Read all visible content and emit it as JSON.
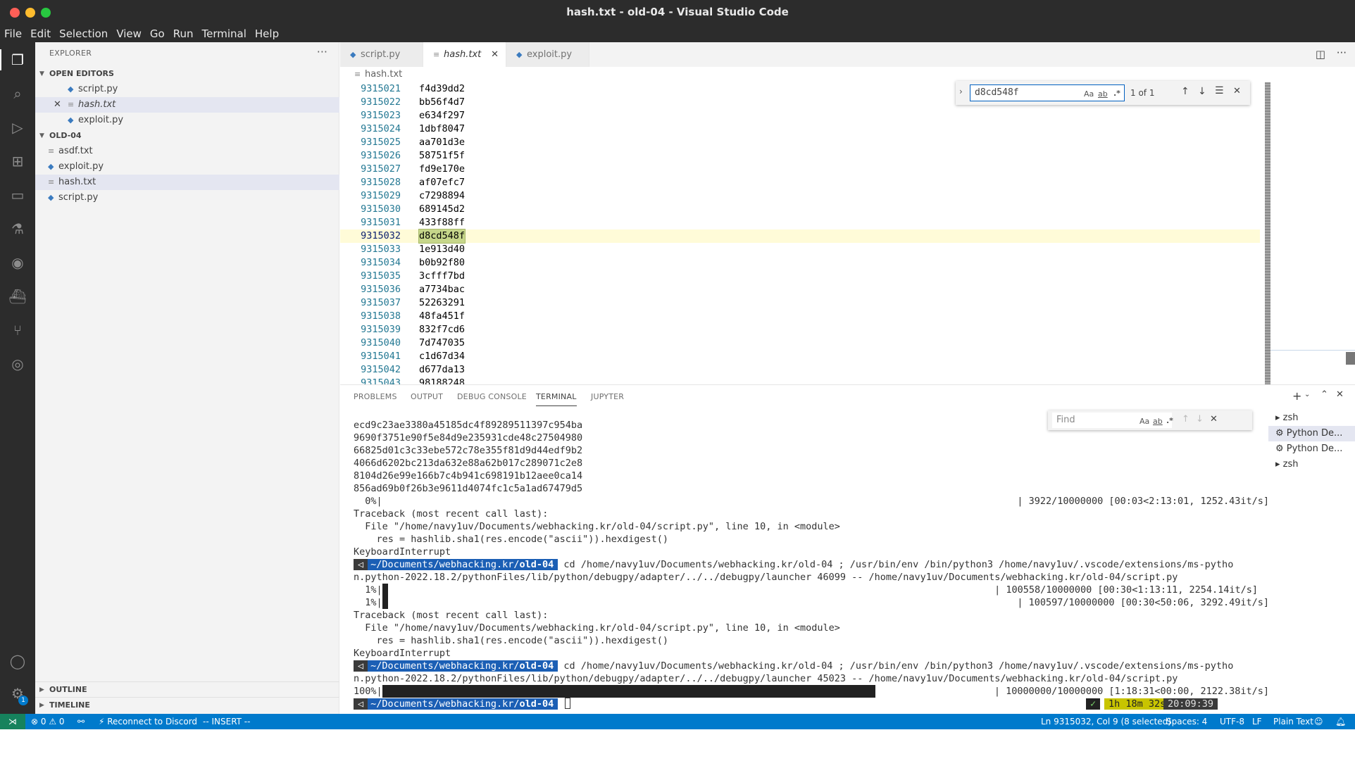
{
  "window": {
    "title": "hash.txt - old-04 - Visual Studio Code",
    "colors": {
      "close": "#ff5f57",
      "minimize": "#febc2e",
      "maximize": "#28c840",
      "accent": "#007acc"
    }
  },
  "menu": [
    "File",
    "Edit",
    "Selection",
    "View",
    "Go",
    "Run",
    "Terminal",
    "Help"
  ],
  "activity_icons": [
    "explorer-icon",
    "search-icon",
    "run-debug-icon",
    "extensions-icon",
    "remote-explorer-icon",
    "testing-icon",
    "git-graph-icon",
    "docker-icon",
    "source-control-icon",
    "github-icon",
    "account-icon",
    "settings-gear-icon"
  ],
  "sidebar": {
    "title": "EXPLORER",
    "open_editors_label": "OPEN EDITORS",
    "open_editors": [
      "script.py",
      "hash.txt",
      "exploit.py"
    ],
    "folder_label": "OLD-04",
    "files": [
      "asdf.txt",
      "exploit.py",
      "hash.txt",
      "script.py"
    ],
    "outline_label": "OUTLINE",
    "timeline_label": "TIMELINE",
    "settings_badge": "1"
  },
  "tabs": [
    "script.py",
    "hash.txt",
    "exploit.py"
  ],
  "breadcrumb": "hash.txt",
  "editor": {
    "lines": [
      {
        "n": "9315021",
        "t": "f4d39dd2"
      },
      {
        "n": "9315022",
        "t": "bb56f4d7"
      },
      {
        "n": "9315023",
        "t": "e634f297"
      },
      {
        "n": "9315024",
        "t": "1dbf8047"
      },
      {
        "n": "9315025",
        "t": "aa701d3e"
      },
      {
        "n": "9315026",
        "t": "58751f5f"
      },
      {
        "n": "9315027",
        "t": "fd9e170e"
      },
      {
        "n": "9315028",
        "t": "af07efc7"
      },
      {
        "n": "9315029",
        "t": "c7298894"
      },
      {
        "n": "9315030",
        "t": "689145d2"
      },
      {
        "n": "9315031",
        "t": "433f88ff"
      },
      {
        "n": "9315032",
        "t": "d8cd548f"
      },
      {
        "n": "9315033",
        "t": "1e913d40"
      },
      {
        "n": "9315034",
        "t": "b0b92f80"
      },
      {
        "n": "9315035",
        "t": "3cfff7bd"
      },
      {
        "n": "9315036",
        "t": "a7734bac"
      },
      {
        "n": "9315037",
        "t": "52263291"
      },
      {
        "n": "9315038",
        "t": "48fa451f"
      },
      {
        "n": "9315039",
        "t": "832f7cd6"
      },
      {
        "n": "9315040",
        "t": "7d747035"
      },
      {
        "n": "9315041",
        "t": "c1d67d34"
      },
      {
        "n": "9315042",
        "t": "d677da13"
      },
      {
        "n": "9315043",
        "t": "98188248"
      }
    ],
    "current_line": "9315032",
    "find": {
      "query": "d8cd548f",
      "match_case": "Aa",
      "whole_word": "ab",
      "regex": ".*",
      "result": "1 of 1"
    }
  },
  "panel": {
    "tabs": [
      "PROBLEMS",
      "OUTPUT",
      "DEBUG CONSOLE",
      "TERMINAL",
      "JUPYTER"
    ],
    "active_tab": "TERMINAL",
    "find_placeholder": "Find",
    "terminal_lines": [
      "ecd9c23ae3380a45185dc4f89289511397c954ba",
      "9690f3751e90f5e84d9e235931cde48c27504980",
      "66825d01c3c33ebe572c78e355f81d9d44edf9b2",
      "4066d6202bc213da632e88a62b017c289071c2e8",
      "8104d26e99e166b7c4b941c698191b12aee0ca14",
      "856ad69b0f26b3e9611d4074fc1c5a1ad67479d5"
    ],
    "progress1_left": "  0%|",
    "progress1_right": "| 3922/10000000 [00:03<2:13:01, 1252.43it/s]",
    "traceback1": [
      "Traceback (most recent call last):",
      "  File \"/home/navy1uv/Documents/webhacking.kr/old-04/script.py\", line 10, in <module>",
      "    res = hashlib.sha1(res.encode(\"ascii\")).hexdigest()",
      "KeyboardInterrupt"
    ],
    "prompt_path": "~/Documents/webhacking.kr/",
    "prompt_dir": "old-04",
    "cmd1a": " cd /home/navy1uv/Documents/webhacking.kr/old-04 ; /usr/bin/env /bin/python3 /home/navy1uv/.vscode/extensions/ms-pytho",
    "cmd1b": "n.python-2022.18.2/pythonFiles/lib/python/debugpy/adapter/../../debugpy/launcher 46099 -- /home/navy1uv/Documents/webhacking.kr/old-04/script.py",
    "progress2_left": "  1%|",
    "progress2_right": "| 100558/10000000 [00:30<1:13:11, 2254.14it/s]",
    "progress3_left": "  1%|",
    "progress3_right": "| 100597/10000000 [00:30<50:06, 3292.49it/s]",
    "traceback2": [
      "Traceback (most recent call last):",
      "  File \"/home/navy1uv/Documents/webhacking.kr/old-04/script.py\", line 10, in <module>",
      "    res = hashlib.sha1(res.encode(\"ascii\")).hexdigest()",
      "KeyboardInterrupt"
    ],
    "cmd2a": " cd /home/navy1uv/Documents/webhacking.kr/old-04 ; /usr/bin/env /bin/python3 /home/navy1uv/.vscode/extensions/ms-pytho",
    "cmd2b": "n.python-2022.18.2/pythonFiles/lib/python/debugpy/adapter/../../debugpy/launcher 45023 -- /home/navy1uv/Documents/webhacking.kr/old-04/script.py",
    "progress4_left": "100%|",
    "progress4_right": "| 10000000/10000000 [1:18:31<00:00, 2122.38it/s]",
    "progress4_fraction": 1.0,
    "status_ok": "✓",
    "elapsed": "1h 18m 32s",
    "clock": "20:09:39",
    "terminals": [
      "zsh",
      "Python De...",
      "Python De...",
      "zsh"
    ]
  },
  "statusbar": {
    "errors": "0",
    "warnings": "0",
    "discord": "Reconnect to Discord",
    "mode": "-- INSERT --",
    "position": "Ln 9315032, Col 9 (8 selected)",
    "spaces": "Spaces: 4",
    "encoding": "UTF-8",
    "eol": "LF",
    "language": "Plain Text"
  }
}
